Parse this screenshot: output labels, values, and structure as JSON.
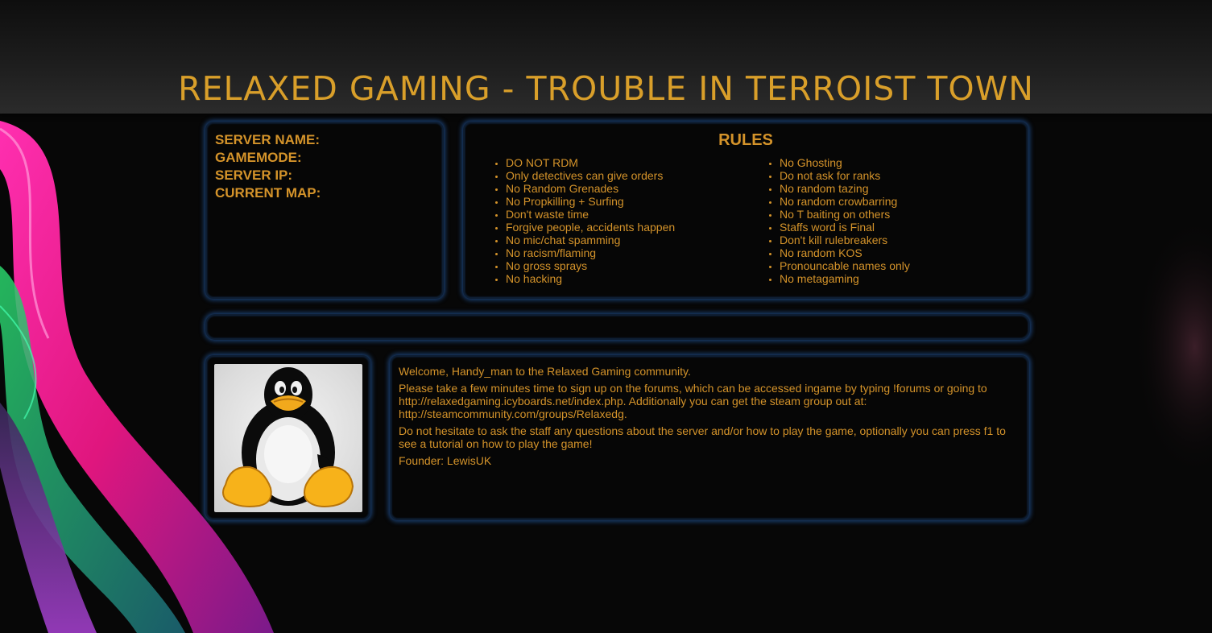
{
  "header": {
    "title": "RELAXED GAMING - TROUBLE IN TERROIST TOWN"
  },
  "server_info": {
    "labels": [
      "SERVER NAME:",
      "GAMEMODE:",
      "SERVER IP:",
      "CURRENT MAP:"
    ]
  },
  "rules": {
    "title": "RULES",
    "left": [
      "DO NOT RDM",
      "Only detectives can give orders",
      "No Random Grenades",
      "No Propkilling + Surfing",
      "Don't waste time",
      "Forgive people, accidents happen",
      "No mic/chat spamming",
      "No racism/flaming",
      "No gross sprays",
      "No hacking"
    ],
    "right": [
      "No Ghosting",
      "Do not ask for ranks",
      "No random tazing",
      "No random crowbarring",
      "No T baiting on others",
      "Staffs word is Final",
      "Don't kill rulebreakers",
      "No random KOS",
      "Pronouncable names only",
      "No metagaming"
    ]
  },
  "avatar": {
    "icon": "linux-penguin-icon"
  },
  "welcome": {
    "line1": "Welcome, Handy_man to the Relaxed Gaming community.",
    "line2": "Please take a few minutes time to sign up on the forums, which can be accessed ingame by typing !forums or going to http://relaxedgaming.icyboards.net/index.php. Additionally you can get the steam group out at: http://steamcommunity.com/groups/Relaxedg.",
    "line3": "Do not hesitate to ask the staff any questions about the server and/or how to play the game, optionally you can press f1 to see a tutorial on how to play the game!",
    "line4": "Founder: LewisUK"
  },
  "colors": {
    "accent": "#d4932a",
    "panel_glow": "#2a6ec8",
    "background": "#070707"
  }
}
